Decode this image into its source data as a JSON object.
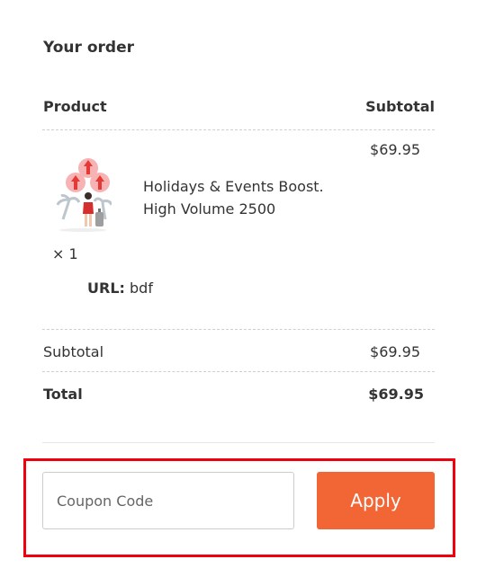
{
  "order": {
    "heading": "Your order",
    "columns": {
      "product": "Product",
      "subtotal": "Subtotal"
    },
    "items": [
      {
        "name": "Holidays & Events Boost.\nHigh Volume 2500",
        "quantity": "× 1",
        "price": "$69.95",
        "meta_label": "URL:",
        "meta_value": "bdf"
      }
    ],
    "subtotal_label": "Subtotal",
    "subtotal_value": "$69.95",
    "total_label": "Total",
    "total_value": "$69.95"
  },
  "coupon": {
    "placeholder": "Coupon Code",
    "value": "",
    "apply_label": "Apply"
  },
  "colors": {
    "accent": "#f26535",
    "highlight_border": "#f0000f"
  },
  "icons": {
    "product_thumbnail": "product-illustration-icon"
  }
}
